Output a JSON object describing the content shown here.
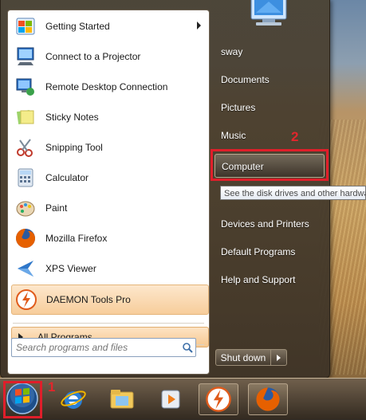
{
  "start_menu": {
    "programs": [
      {
        "label": "Getting Started",
        "icon": "getting-started-icon",
        "has_submenu": true
      },
      {
        "label": "Connect to a Projector",
        "icon": "projector-icon"
      },
      {
        "label": "Remote Desktop Connection",
        "icon": "remote-desktop-icon"
      },
      {
        "label": "Sticky Notes",
        "icon": "sticky-notes-icon"
      },
      {
        "label": "Snipping Tool",
        "icon": "scissors-icon"
      },
      {
        "label": "Calculator",
        "icon": "calculator-icon"
      },
      {
        "label": "Paint",
        "icon": "paint-palette-icon"
      },
      {
        "label": "Mozilla Firefox",
        "icon": "firefox-icon"
      },
      {
        "label": "XPS Viewer",
        "icon": "xps-viewer-icon"
      },
      {
        "label": "DAEMON Tools Pro",
        "icon": "daemon-tools-icon",
        "highlighted": true
      }
    ],
    "all_programs_label": "All Programs",
    "search": {
      "placeholder": "Search programs and files"
    },
    "right_items": [
      "sway",
      "Documents",
      "Pictures",
      "Music",
      "Computer",
      "Devices and Printers",
      "Default Programs",
      "Help and Support"
    ],
    "highlighted_right_item": "Computer",
    "tooltip": "See the disk drives and other hardware",
    "shutdown_label": "Shut down"
  },
  "annotations": {
    "marker_1": "1",
    "marker_2": "2"
  },
  "taskbar": {
    "buttons": [
      "start-orb-icon",
      "internet-explorer-icon",
      "windows-explorer-icon",
      "media-player-icon",
      "daemon-tools-icon",
      "firefox-icon"
    ]
  },
  "colors": {
    "highlight_red": "#e01e2a",
    "menu_orange": "#f7cd9b"
  }
}
